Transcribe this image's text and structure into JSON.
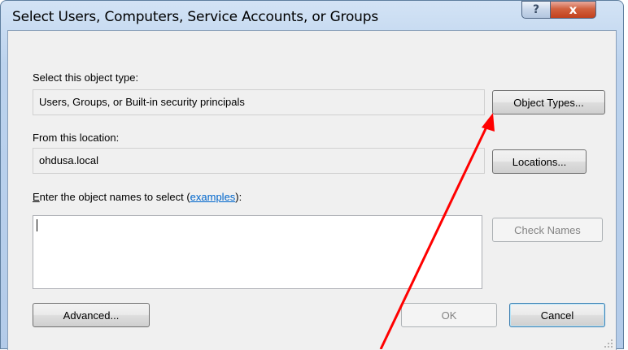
{
  "window": {
    "title": "Select Users, Computers, Service Accounts, or Groups",
    "help_glyph": "?",
    "close_glyph": "x"
  },
  "object_type": {
    "label": "Select this object type:",
    "value": "Users, Groups, or Built-in security principals",
    "button_label": "Object Types..."
  },
  "location": {
    "label": "From this location:",
    "value": "ohdusa.local",
    "button_label": "Locations..."
  },
  "names": {
    "label_prefix_underlined": "E",
    "label_prefix_rest": "nter the object names to select (",
    "link_text": "examples",
    "label_suffix": "):",
    "value": "",
    "check_names_label": "Check Names"
  },
  "footer": {
    "advanced_label": "Advanced...",
    "ok_label": "OK",
    "cancel_label": "Cancel"
  },
  "annotation": {
    "arrow_color": "#ff0000"
  }
}
